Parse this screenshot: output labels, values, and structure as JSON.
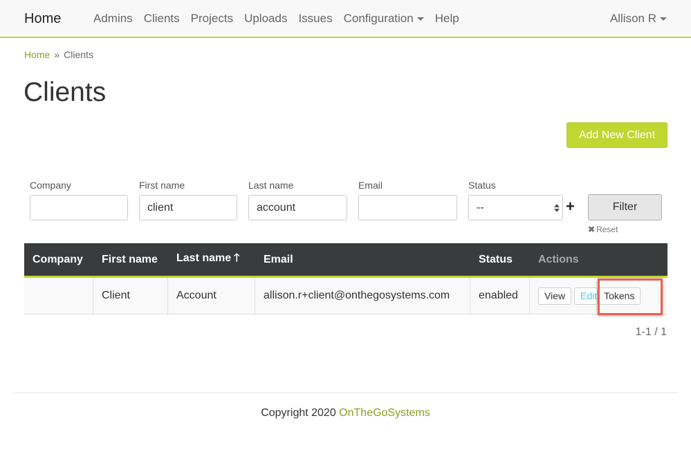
{
  "navbar": {
    "brand": "Home",
    "links": [
      "Admins",
      "Clients",
      "Projects",
      "Uploads",
      "Issues",
      "Configuration",
      "Help"
    ],
    "user": "Allison R"
  },
  "breadcrumb": {
    "home": "Home",
    "separator": "»",
    "current": "Clients"
  },
  "page": {
    "title": "Clients",
    "add_button": "Add New Client"
  },
  "filters": {
    "company_label": "Company",
    "company_value": "",
    "first_name_label": "First name",
    "first_name_value": "client",
    "last_name_label": "Last name",
    "last_name_value": "account",
    "email_label": "Email",
    "email_value": "",
    "status_label": "Status",
    "status_value": "--",
    "add_icon": "plus-icon",
    "filter_button": "Filter",
    "reset_label": "Reset"
  },
  "table": {
    "headers": [
      "Company",
      "First name",
      "Last name",
      "Email",
      "Status",
      "Actions"
    ],
    "sort_icon": "arrow-up-icon",
    "rows": [
      {
        "company": "",
        "first_name": "Client",
        "last_name": "Account",
        "email": "allison.r+client@onthegosystems.com",
        "status": "enabled",
        "actions": {
          "view": "View",
          "edit": "Edit",
          "tokens": "Tokens"
        }
      }
    ]
  },
  "pagination": "1-1 / 1",
  "footer": {
    "text": "Copyright 2020",
    "link": "OnTheGoSystems"
  },
  "colors": {
    "accent": "#bfd730",
    "header_bg": "#3a3b3d",
    "highlight": "#e8604f",
    "link": "#8aa01f"
  }
}
